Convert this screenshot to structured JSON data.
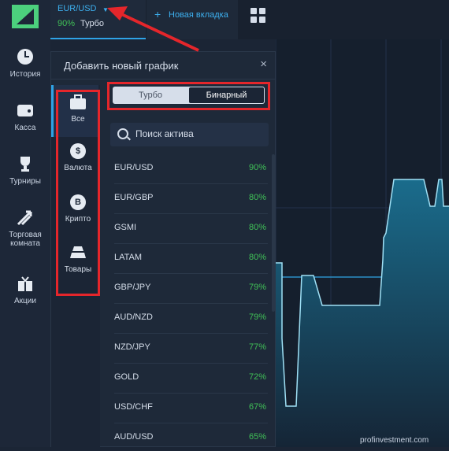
{
  "sidebar": {
    "items": [
      {
        "label": "История",
        "icon": "clock-icon"
      },
      {
        "label": "Касса",
        "icon": "wallet-icon"
      },
      {
        "label": "Турниры",
        "icon": "trophy-icon"
      },
      {
        "label": "Торговая комната",
        "icon": "trade-arrows-icon"
      },
      {
        "label": "Акции",
        "icon": "gift-icon"
      }
    ]
  },
  "top": {
    "pair": "EUR/USD",
    "pair_pct": "90%",
    "pair_mode": "Турбо",
    "new_tab": "Новая вкладка"
  },
  "modal": {
    "title": "Добавить новый график",
    "close": "×",
    "categories": [
      {
        "label": "Все",
        "icon": "briefcase-icon"
      },
      {
        "label": "Валюта",
        "icon": "dollar-coin-icon"
      },
      {
        "label": "Крипто",
        "icon": "bitcoin-icon"
      },
      {
        "label": "Товары",
        "icon": "gold-bars-icon"
      }
    ],
    "toggle": {
      "turbo": "Турбо",
      "binary": "Бинарный"
    },
    "search_placeholder": "Поиск актива",
    "assets": [
      {
        "name": "EUR/USD",
        "pct": "90%"
      },
      {
        "name": "EUR/GBP",
        "pct": "80%"
      },
      {
        "name": "GSMI",
        "pct": "80%"
      },
      {
        "name": "LATAM",
        "pct": "80%"
      },
      {
        "name": "GBP/JPY",
        "pct": "79%"
      },
      {
        "name": "AUD/NZD",
        "pct": "79%"
      },
      {
        "name": "NZD/JPY",
        "pct": "77%"
      },
      {
        "name": "GOLD",
        "pct": "72%"
      },
      {
        "name": "USD/CHF",
        "pct": "67%"
      },
      {
        "name": "AUD/USD",
        "pct": "65%"
      }
    ]
  },
  "watermark": "profinvestment.com",
  "colors": {
    "accent": "#2fa3e6",
    "positive": "#40c057",
    "highlight": "#e5262b"
  }
}
